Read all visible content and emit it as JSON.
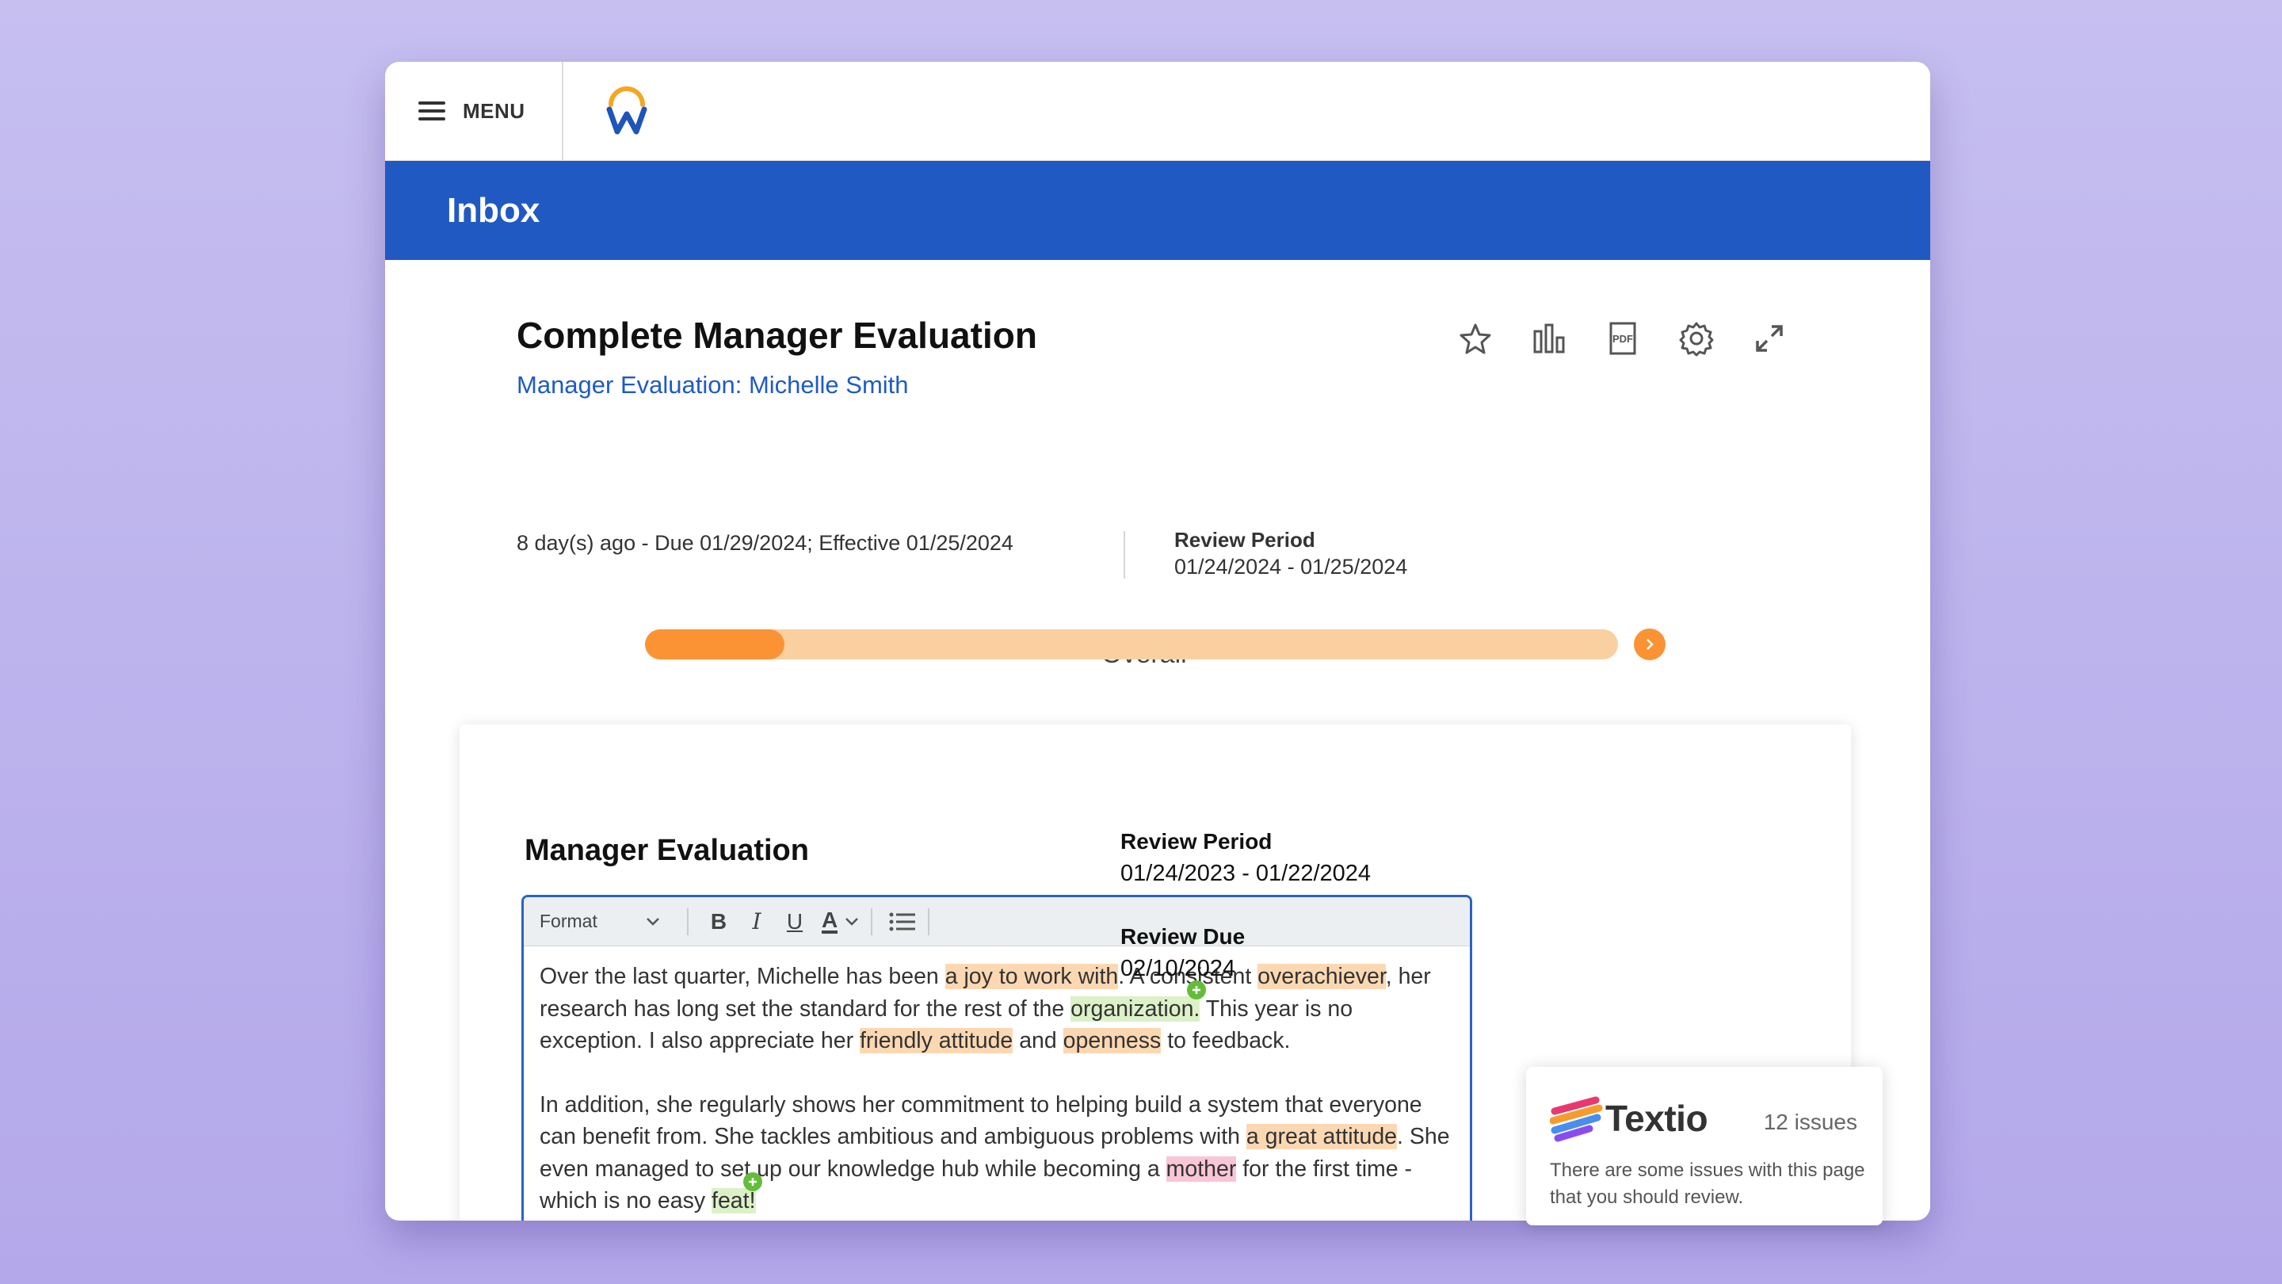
{
  "topbar": {
    "menu_label": "MENU"
  },
  "header": {
    "title": "Inbox"
  },
  "task": {
    "title": "Complete Manager Evaluation",
    "subtitle_link": "Manager Evaluation: Michelle Smith",
    "due_text": "8 day(s) ago - Due 01/29/2024; Effective 01/25/2024",
    "review_period_label": "Review Period",
    "review_period_value": "01/24/2024 - 01/25/2024",
    "icons": [
      "star-icon",
      "bar-chart-icon",
      "pdf-icon",
      "gear-icon",
      "expand-icon"
    ]
  },
  "progress": {
    "label": "Overall",
    "fraction": 0.143,
    "colors": {
      "fill": "#fb9334",
      "track": "#fbd0a0"
    }
  },
  "card": {
    "title": "Manager Evaluation",
    "editor": {
      "format_label": "Format",
      "paragraphs": [
        [
          {
            "t": "Over the last quarter, Michelle has been "
          },
          {
            "t": "a joy to work with",
            "h": "o"
          },
          {
            "t": ". A consistent "
          },
          {
            "t": "overachiever",
            "h": "o"
          },
          {
            "t": ", her research has long set the standard for the rest of the "
          },
          {
            "t": "organization.",
            "h": "g"
          },
          {
            "t": " This year is no exception. I also appreciate her "
          },
          {
            "t": "friendly attitude",
            "h": "o"
          },
          {
            "t": " and "
          },
          {
            "t": "openness",
            "h": "o"
          },
          {
            "t": " to feedback."
          }
        ],
        [
          {
            "t": "In addition, she regularly shows her commitment to helping build a system that everyone can benefit from. She tackles ambitious and ambiguous problems with "
          },
          {
            "t": "a great attitude",
            "h": "o"
          },
          {
            "t": ".  She even managed to set up our knowledge hub while becoming a "
          },
          {
            "t": "mother",
            "h": "p"
          },
          {
            "t": " for the first time - which is no easy "
          },
          {
            "t": "feat!",
            "h": "g"
          }
        ]
      ]
    },
    "side": {
      "review_period_label": "Review Period",
      "review_period_value": "01/24/2023 - 01/22/2024",
      "review_due_label": "Review Due",
      "review_due_value": "02/10/2024"
    }
  },
  "textio": {
    "name": "Textio",
    "issues": "12 issues",
    "message": "There are some issues with this page that you should review."
  },
  "colors": {
    "brand_blue": "#2059c2",
    "link_blue": "#1e5bc6",
    "highlight_orange": "#fcd8b2",
    "highlight_green": "#dcf1c8",
    "highlight_pink": "#f8c6d6"
  }
}
